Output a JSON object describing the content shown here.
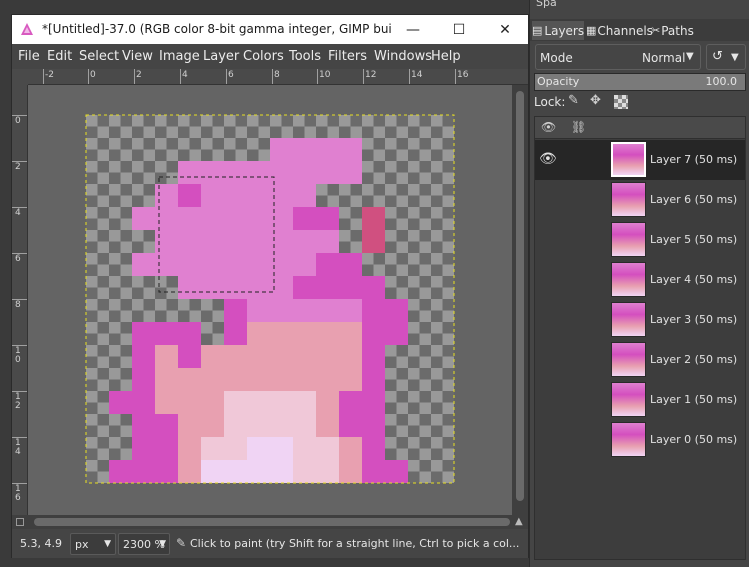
{
  "dock_top_label": "Spa",
  "window": {
    "title": "*[Untitled]-37.0 (RGB color 8-bit gamma integer, GIMP built-in s...",
    "minimize": "—",
    "maximize": "☐",
    "close": "✕"
  },
  "menu": [
    "File",
    "Edit",
    "Select",
    "View",
    "Image",
    "Layer",
    "Colors",
    "Tools",
    "Filters",
    "Windows",
    "Help"
  ],
  "hruler_labels": [
    "-2",
    "0",
    "2",
    "4",
    "6",
    "8",
    "10",
    "12",
    "14",
    "16"
  ],
  "vruler_labels": [
    "0",
    "2",
    "4",
    "6",
    "8",
    "1\n0",
    "1\n2",
    "1\n4",
    "1\n6"
  ],
  "status": {
    "coords": "5.3, 4.9",
    "unit": "px",
    "zoom": "2300 %",
    "message": "Click to paint (try Shift for a straight line, Ctrl to pick a col..."
  },
  "dock": {
    "tabs": [
      "Layers",
      "Channels",
      "Paths"
    ],
    "mode_label": "Mode",
    "mode_value": "Normal",
    "opacity_label": "Opacity",
    "opacity_value": "100.0",
    "opacity_fraction": 1.0,
    "lock_label": "Lock:"
  },
  "layers": [
    {
      "name": "Layer 7 (50 ms)",
      "visible": true,
      "selected": true
    },
    {
      "name": "Layer 6 (50 ms)",
      "visible": false,
      "selected": false
    },
    {
      "name": "Layer 5 (50 ms)",
      "visible": false,
      "selected": false
    },
    {
      "name": "Layer 4 (50 ms)",
      "visible": false,
      "selected": false
    },
    {
      "name": "Layer 3 (50 ms)",
      "visible": false,
      "selected": false
    },
    {
      "name": "Layer 2 (50 ms)",
      "visible": false,
      "selected": false
    },
    {
      "name": "Layer 1 (50 ms)",
      "visible": false,
      "selected": false
    },
    {
      "name": "Layer 0 (50 ms)",
      "visible": false,
      "selected": false
    }
  ],
  "colors": {
    "magenta": "#d44fbf",
    "orchid": "#e080d0",
    "pink": "#e8a0b0",
    "lightpink": "#f0c8d8",
    "lavender": "#f0d4f4",
    "rose": "#d05080",
    "check_light": "#999999",
    "check_dark": "#6b6b6b"
  },
  "pixel_art": {
    "cols": 16,
    "rows": 16,
    "rows_data": [
      "               ",
      "        LLLL     ",
      "    PPPPPPPP     ",
      "   PMPPPPP       ",
      "  PPPPPPPMM R    ",
      "   PPPPPPPP R    ",
      "  PPPPPPPPMM     ",
      "    PPPPPMMMM    ",
      "      MPPPPPMM   ",
      "  MMM MAAAAAMM   ",
      "  MAMAAAAAAAM    ",
      "  MAAAAAAAAAM    ",
      " MMAAABBBBAMM    ",
      "  MMAABBBBAMM    ",
      "  MMABBVVBBAM    ",
      " MMMAVVVVBBAMM   "
    ]
  }
}
